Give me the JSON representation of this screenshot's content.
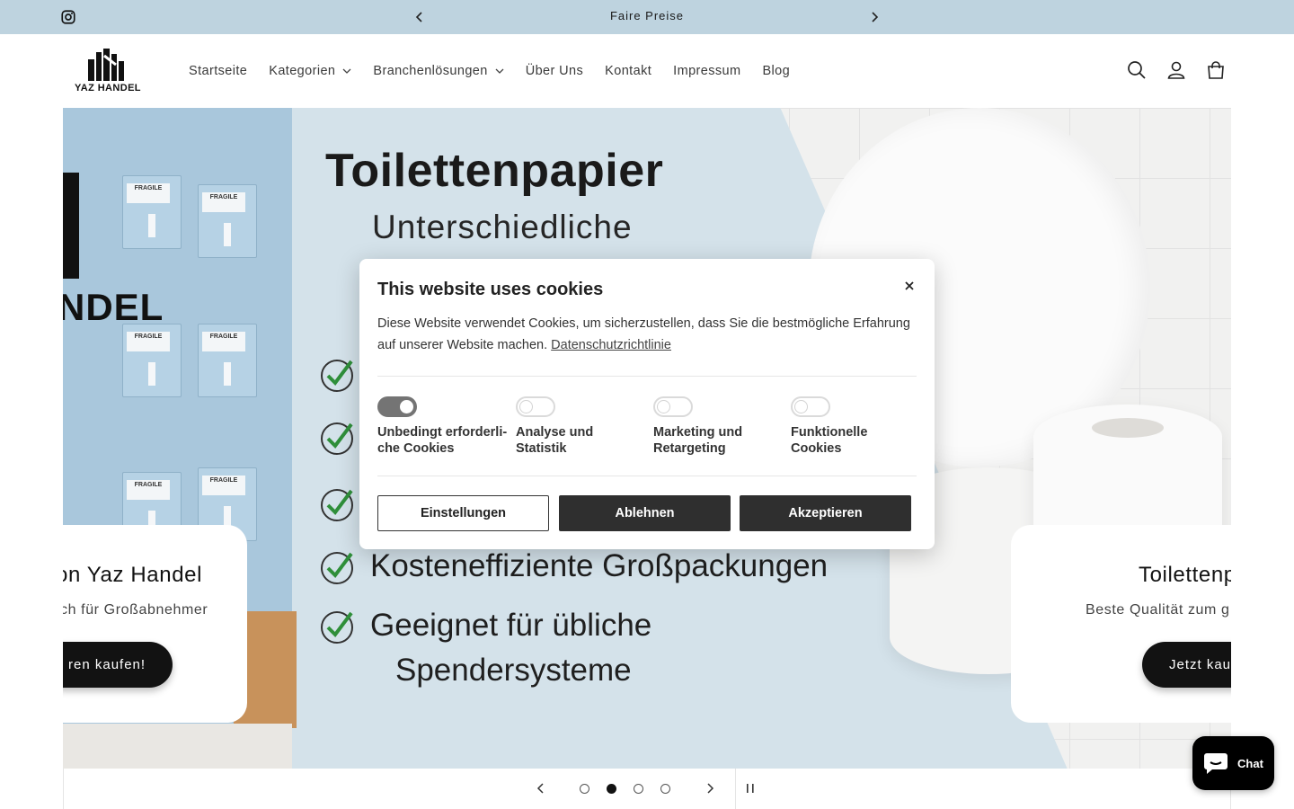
{
  "announcement": {
    "message": "Faire Preise"
  },
  "header": {
    "logo_text": "YAZ HANDEL",
    "nav": [
      {
        "label": "Startseite",
        "has_dropdown": false
      },
      {
        "label": "Kategorien",
        "has_dropdown": true
      },
      {
        "label": "Branchenlösungen",
        "has_dropdown": true
      },
      {
        "label": "Über Uns",
        "has_dropdown": false
      },
      {
        "label": "Kontakt",
        "has_dropdown": false
      },
      {
        "label": "Impressum",
        "has_dropdown": false
      },
      {
        "label": "Blog",
        "has_dropdown": false
      }
    ],
    "icons": [
      "search-icon",
      "account-icon",
      "cart-icon"
    ]
  },
  "hero": {
    "image_text_left": "NDEL",
    "box_label": "FRAGILE",
    "title": "Toilettenpapier",
    "subtitle": "Unterschiedliche",
    "bullets": [
      "Kosteneffiziente Großpackungen",
      "Geeignet für übliche",
      "Spendersysteme"
    ],
    "card_left": {
      "title": "on Yaz Handel",
      "subtitle": "ch für Großabnehmer",
      "button": "ren kaufen!"
    },
    "card_right": {
      "title": "Toilettenp",
      "subtitle": "Beste Qualität zum g",
      "button": "Jetzt kau"
    }
  },
  "slider": {
    "slide_count": 4,
    "active_index": 1
  },
  "cookie_modal": {
    "title": "This website uses cookies",
    "text": "Diese Website verwendet Cookies, um sicherzustellen, dass Sie die bestmögliche Erfahrung auf unserer Website machen.",
    "link": "Datenschutzrichtlinie",
    "toggles": [
      {
        "label": "Unbedingt erforderli-che Cookies",
        "label_line1": "Unbedingt erforderli-",
        "label_line2": "che Cookies",
        "on": true
      },
      {
        "label": "Analyse und Statistik",
        "label_line1": "Analyse und",
        "label_line2": "Statistik",
        "on": false
      },
      {
        "label": "Marketing und Retargeting",
        "label_line1": "Marketing und",
        "label_line2": "Retargeting",
        "on": false
      },
      {
        "label": "Funktionelle Cookies",
        "label_line1": "Funktionelle",
        "label_line2": "Cookies",
        "on": false
      }
    ],
    "buttons": {
      "settings": "Einstellungen",
      "decline": "Ablehnen",
      "accept": "Akzeptieren"
    }
  },
  "chat": {
    "label": "Chat"
  },
  "colors": {
    "announcement_bg": "#bed3df",
    "hero_bg": "#d4e2ea",
    "button_dark": "#2f2f2f",
    "check_green": "#2f8f3a"
  }
}
